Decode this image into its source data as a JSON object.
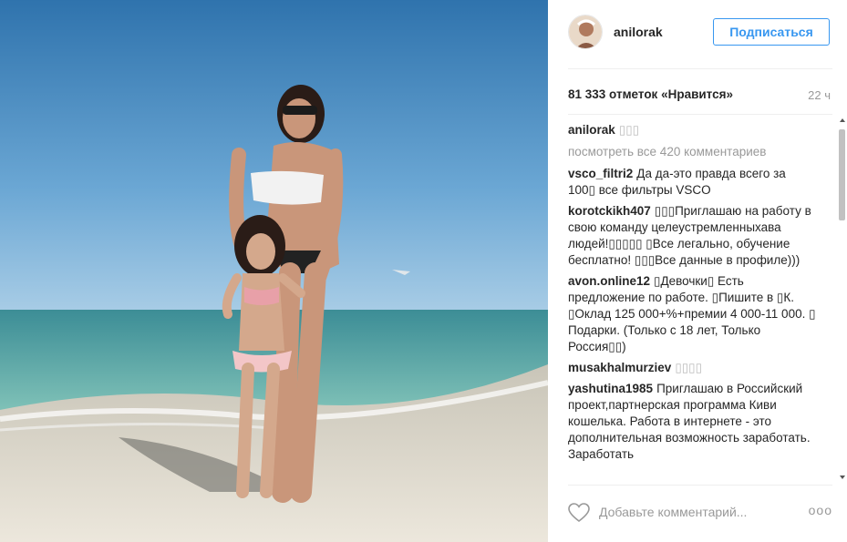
{
  "post": {
    "username": "anilorak",
    "follow_label": "Подписаться",
    "likes": "81 333 отметок «Нравится»",
    "time_ago": "22 ч",
    "view_all": "посмотреть все 420 комментариев",
    "add_comment_placeholder": "Добавьте комментарий...",
    "more_label": "ooo",
    "caption": {
      "user": "anilorak",
      "text": "▯▯▯"
    },
    "comments": [
      {
        "user": "vsco_filtri2",
        "text": "Да да-это правда всего за 100▯ все фильтры VSCO"
      },
      {
        "user": "korotckikh407",
        "text": "▯▯▯Приглашаю на работу в свою команду целеустремленныхава людей!▯▯▯▯▯ ▯Все легально, обучение бесплатно! ▯▯▯Все данные в профиле)))"
      },
      {
        "user": "avon.online12",
        "text": "▯Девочки▯ Есть предложение по работе. ▯Пишите в ▯К. ▯Оклад 125 000+%+премии 4 000-11 000. ▯ Подарки. (Только с 18 лет, Только Россия▯▯)"
      },
      {
        "user": "musakhalmurziev",
        "text": "▯▯▯▯"
      },
      {
        "user": "yashutina1985",
        "text": "Приглашаю в Российский проект,партнерская программа Киви кошелька. Работа в интернете - это дополнительная возможность заработать. Заработать"
      }
    ]
  },
  "colors": {
    "accent": "#3897f0",
    "muted": "#999999",
    "text": "#262626"
  },
  "icons": {
    "heart": "heart-outline-icon"
  }
}
